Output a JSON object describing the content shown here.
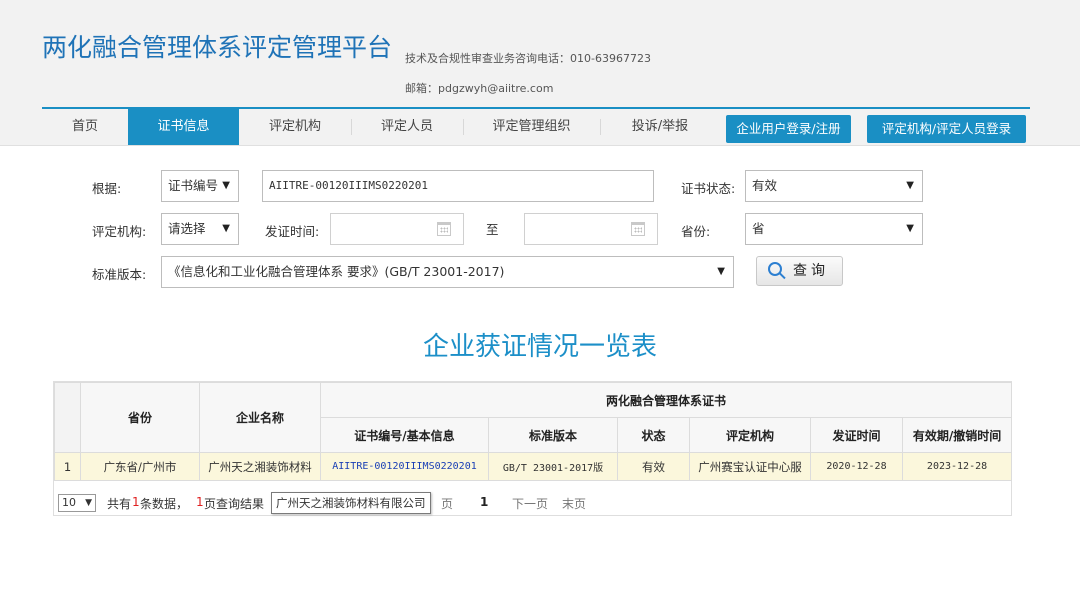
{
  "header": {
    "title": "两化融合管理体系评定管理平台",
    "phone": "技术及合规性审查业务咨询电话：010-63967723",
    "email": "邮箱：pdgzwyh@aiitre.com"
  },
  "nav": {
    "items": [
      "首页",
      "证书信息",
      "评定机构",
      "评定人员",
      "评定管理组织",
      "投诉/举报"
    ],
    "active": "证书信息",
    "enterprise_login": "企业用户登录/注册",
    "institution_login": "评定机构/评定人员登录"
  },
  "form": {
    "basis_label": "根据:",
    "basis_value": "证书编号",
    "cert_number_value": "AIITRE-00120IIIMS0220201",
    "status_label": "证书状态:",
    "status_value": "有效",
    "institution_label": "评定机构:",
    "institution_value": "请选择",
    "issue_date_label": "发证时间:",
    "to_label": "至",
    "province_label": "省份:",
    "province_value": "省",
    "standard_label": "标准版本:",
    "standard_value": "《信息化和工业化融合管理体系 要求》(GB/T 23001-2017)",
    "query_label": "查询"
  },
  "list_title": "企业获证情况一览表",
  "table": {
    "group_header": "两化融合管理体系证书",
    "col_province": "省份",
    "col_company": "企业名称",
    "col_cert": "证书编号/基本信息",
    "col_standard": "标准版本",
    "col_status": "状态",
    "col_institution": "评定机构",
    "col_issue": "发证时间",
    "col_expiry": "有效期/撤销时间",
    "rows": [
      {
        "index": "1",
        "province": "广东省/广州市",
        "company": "广州天之湘装饰材料",
        "cert": "AIITRE-00120IIIMS0220201",
        "standard": "GB/T 23001-2017版",
        "status": "有效",
        "institution": "广州赛宝认证中心服",
        "issue": "2020-12-28",
        "expiry": "2023-12-28"
      }
    ]
  },
  "pager": {
    "page_size": "10",
    "total_prefix": "共有",
    "total_count": "1",
    "total_mid": "条数据，",
    "pages_count": "1",
    "pages_suffix": "页查询结果",
    "tooltip": "广州天之湘装饰材料有限公司",
    "prev_tail": "页",
    "current_page": "1",
    "next": "下一页",
    "last": "末页"
  },
  "colors": {
    "accent": "#1a8fc4",
    "title": "#1f73b7",
    "row_highlight": "#fbf7dc",
    "count_red": "#e02020"
  }
}
